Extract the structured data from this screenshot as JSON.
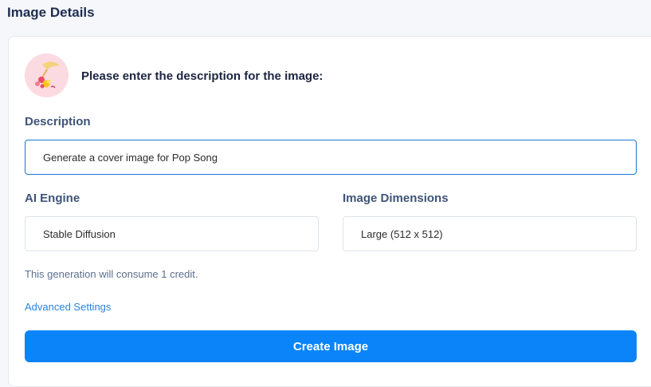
{
  "page": {
    "title": "Image Details"
  },
  "card": {
    "heading": "Please enter the description for the image:",
    "avatar_icon": "art-illustration-icon"
  },
  "description": {
    "label": "Description",
    "value": "Generate a cover image for Pop Song"
  },
  "engine": {
    "label": "AI Engine",
    "value": "Stable Diffusion"
  },
  "dimensions": {
    "label": "Image Dimensions",
    "value": "Large (512 x 512)"
  },
  "credit_note": "This generation will consume 1 credit.",
  "advanced_link": "Advanced Settings",
  "create_button": "Create Image",
  "colors": {
    "accent": "#0a84f8",
    "link": "#2b84dd",
    "input_focus": "#1976d2",
    "avatar_bg": "#fbdbe1"
  }
}
